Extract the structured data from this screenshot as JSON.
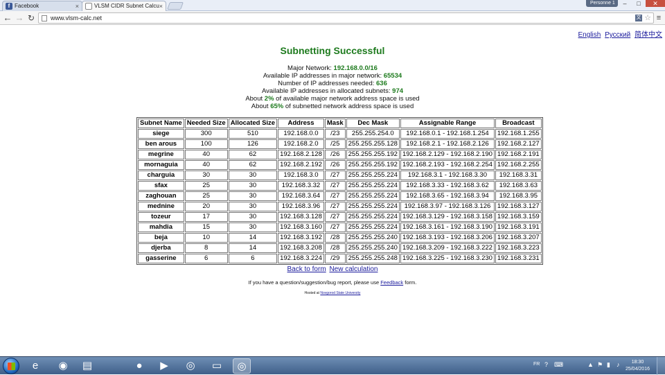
{
  "browser": {
    "tabs": [
      {
        "title": "Facebook",
        "close": "×"
      },
      {
        "title": "VLSM CIDR Subnet Calcu",
        "close": "×"
      }
    ],
    "profile": "Personne 1",
    "window_controls": {
      "min": "–",
      "max": "□",
      "close": "✕"
    },
    "url": "www.vlsm-calc.net",
    "nav": {
      "back": "←",
      "forward": "→",
      "reload": "↻",
      "menu": "≡",
      "star": "☆",
      "translate": "文"
    }
  },
  "page": {
    "languages": [
      "English",
      "Русский",
      "简体中文"
    ],
    "heading": "Subnetting Successful",
    "summary": {
      "major_network_label": "Major Network:",
      "major_network": "192.168.0.0/16",
      "available_major_label": "Available IP addresses in major network:",
      "available_major": "65534",
      "needed_label": "Number of IP addresses needed:",
      "needed": "636",
      "allocated_label": "Available IP addresses in allocated subnets:",
      "allocated": "974",
      "about1_prefix": "About",
      "about1_pct": "2%",
      "about1_suffix": "of available major network address space is used",
      "about2_prefix": "About",
      "about2_pct": "65%",
      "about2_suffix": "of subnetted network address space is used"
    },
    "table": {
      "headers": [
        "Subnet Name",
        "Needed Size",
        "Allocated Size",
        "Address",
        "Mask",
        "Dec Mask",
        "Assignable Range",
        "Broadcast"
      ],
      "rows": [
        [
          "siege",
          "300",
          "510",
          "192.168.0.0",
          "/23",
          "255.255.254.0",
          "192.168.0.1 - 192.168.1.254",
          "192.168.1.255"
        ],
        [
          "ben arous",
          "100",
          "126",
          "192.168.2.0",
          "/25",
          "255.255.255.128",
          "192.168.2.1 - 192.168.2.126",
          "192.168.2.127"
        ],
        [
          "megrine",
          "40",
          "62",
          "192.168.2.128",
          "/26",
          "255.255.255.192",
          "192.168.2.129 - 192.168.2.190",
          "192.168.2.191"
        ],
        [
          "mornaguia",
          "40",
          "62",
          "192.168.2.192",
          "/26",
          "255.255.255.192",
          "192.168.2.193 - 192.168.2.254",
          "192.168.2.255"
        ],
        [
          "charguia",
          "30",
          "30",
          "192.168.3.0",
          "/27",
          "255.255.255.224",
          "192.168.3.1 - 192.168.3.30",
          "192.168.3.31"
        ],
        [
          "sfax",
          "25",
          "30",
          "192.168.3.32",
          "/27",
          "255.255.255.224",
          "192.168.3.33 - 192.168.3.62",
          "192.168.3.63"
        ],
        [
          "zaghouan",
          "25",
          "30",
          "192.168.3.64",
          "/27",
          "255.255.255.224",
          "192.168.3.65 - 192.168.3.94",
          "192.168.3.95"
        ],
        [
          "mednine",
          "20",
          "30",
          "192.168.3.96",
          "/27",
          "255.255.255.224",
          "192.168.3.97 - 192.168.3.126",
          "192.168.3.127"
        ],
        [
          "tozeur",
          "17",
          "30",
          "192.168.3.128",
          "/27",
          "255.255.255.224",
          "192.168.3.129 - 192.168.3.158",
          "192.168.3.159"
        ],
        [
          "mahdia",
          "15",
          "30",
          "192.168.3.160",
          "/27",
          "255.255.255.224",
          "192.168.3.161 - 192.168.3.190",
          "192.168.3.191"
        ],
        [
          "beja",
          "10",
          "14",
          "192.168.3.192",
          "/28",
          "255.255.255.240",
          "192.168.3.193 - 192.168.3.206",
          "192.168.3.207"
        ],
        [
          "djerba",
          "8",
          "14",
          "192.168.3.208",
          "/28",
          "255.255.255.240",
          "192.168.3.209 - 192.168.3.222",
          "192.168.3.223"
        ],
        [
          "gasserine",
          "6",
          "6",
          "192.168.3.224",
          "/29",
          "255.255.255.248",
          "192.168.3.225 - 192.168.3.230",
          "192.168.3.231"
        ]
      ]
    },
    "links": {
      "back": "Back to form",
      "new": "New calculation"
    },
    "feedback": {
      "prefix": "If you have a question/suggestion/bug report, please use",
      "link": "Feedback",
      "suffix": "form."
    },
    "hosted": {
      "prefix": "Hosted at",
      "link": "Novgorod State University"
    }
  },
  "taskbar": {
    "apps": [
      {
        "name": "internet-explorer",
        "glyph": "e"
      },
      {
        "name": "firefox",
        "glyph": "◉"
      },
      {
        "name": "winrar",
        "glyph": "▤"
      },
      {
        "name": "media-player",
        "glyph": "●"
      },
      {
        "name": "video-player",
        "glyph": "▶"
      },
      {
        "name": "chrome",
        "glyph": "◎"
      },
      {
        "name": "file-explorer",
        "glyph": "▭"
      },
      {
        "name": "chrome-active",
        "glyph": "◎"
      }
    ],
    "language": "FR",
    "time": "18:30",
    "date": "25/04/2016"
  }
}
